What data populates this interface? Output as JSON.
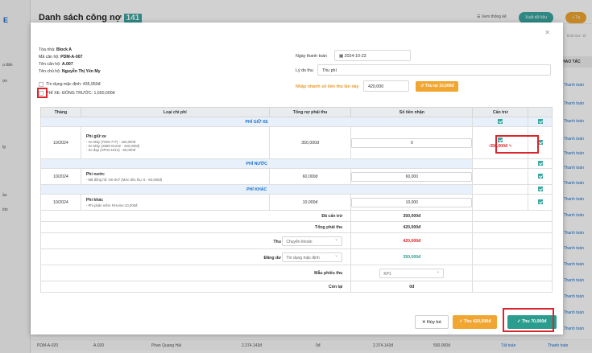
{
  "background": {
    "logo": "E",
    "title": "Danh sách công nợ",
    "count": "141",
    "sidebar_labels": [
      "u dân",
      "ợn",
      "ig",
      "ầu",
      "ido"
    ],
    "link_stats": "Xem thống kê",
    "btn_export": "Xuất dữ liệu",
    "btn_add": "+ Tạ",
    "hint_text": "khối lớn:: tổ",
    "col_header": "HAO TÁC",
    "action_label": "Thanh toán",
    "bottom_row": [
      "PDM-A-020",
      "A.020",
      "Phan Quang Hải",
      "2.374.143đ",
      "0đ",
      "2.374.143đ",
      "500.000đ",
      "Tất toán",
      "Thanh toán"
    ]
  },
  "info": {
    "block": {
      "label": "Tòa nhà:",
      "value": "Block A"
    },
    "unit_code": {
      "label": "Mã căn hộ:",
      "value": "PDM-A-007"
    },
    "unit_name": {
      "label": "Tên căn hộ:",
      "value": "A.007"
    },
    "owner": {
      "label": "Tên chủ hộ:",
      "value": "Nguyễn Thị Yến My"
    }
  },
  "credit_limit": "Tín dụng mặc định: 435,950đ",
  "prepaid_fee": "PHÍ XE- ĐÓNG TRƯỚC: 1,650,000đ",
  "form": {
    "pay_date_label": "Ngày thanh toán",
    "pay_date_value": "2024-10-23",
    "reason_label": "Lý do thu",
    "reason_value": "Thu phí",
    "quick_label": "Nhập nhanh số tiền thu lần này",
    "quick_value": "420,000",
    "quick_button": "Thu lại 10,000đ"
  },
  "table": {
    "headers": [
      "Tháng",
      "Loại chi phí",
      "Tổng nợ phải thu",
      "Số tiền nhận",
      "Cấn trừ"
    ],
    "sections": [
      {
        "title": "PHÍ GIỮ XE",
        "row": {
          "month": "10/2024",
          "fee": "Phí giữ xe",
          "details": [
            "- Xe Máy (TIED-777) - 150,000đ",
            "- Xe Máy (43B9-01232 - 150,000đ)",
            "- Xe đạp (XP04-1013) - 50,000đ"
          ],
          "total": "350,000đ",
          "received": "0",
          "offset": "-350,000đ"
        }
      },
      {
        "title": "PHÍ NƯỚC",
        "row": {
          "month": "10/2024",
          "fee": "Phí nước",
          "details": [
            "- Mã đồng hồ: NS-007 (Mức tiêu thụ: 6 - 60,000đ)"
          ],
          "total": "60,000đ",
          "received": "60,000"
        }
      },
      {
        "title": "PHÍ KHÁC",
        "row": {
          "month": "10/2024",
          "fee": "Phí khác",
          "details": [
            "- Phí phản mềm FiHome:10,000đ"
          ],
          "total": "10,000đ",
          "received": "10,000"
        }
      }
    ],
    "summary": {
      "offset_label": "Đã cấn trừ",
      "offset_value": "350,000đ",
      "total_label": "Tổng phải thu",
      "total_value": "420,000đ",
      "collect_label": "Thu",
      "collect_method": "Chuyển khoản",
      "collect_value": "420,000đ",
      "debt_label": "Đăng dư",
      "debt_method": "Tín dụng mặc định",
      "debt_value": "350,000đ",
      "receipt_label": "Mẫu phiếu thu",
      "receipt_value": "KP1",
      "remain_label": "Còn lại",
      "remain_value": "0đ"
    }
  },
  "footer": {
    "cancel": "Hủy bỏ",
    "pay_orange": "Thu 420,000đ",
    "pay_teal": "Thu 70,000đ"
  },
  "colors": {
    "teal": "#3aa7a1",
    "orange": "#f0a630",
    "red": "#d9262c",
    "blue": "#1a6fc9"
  }
}
